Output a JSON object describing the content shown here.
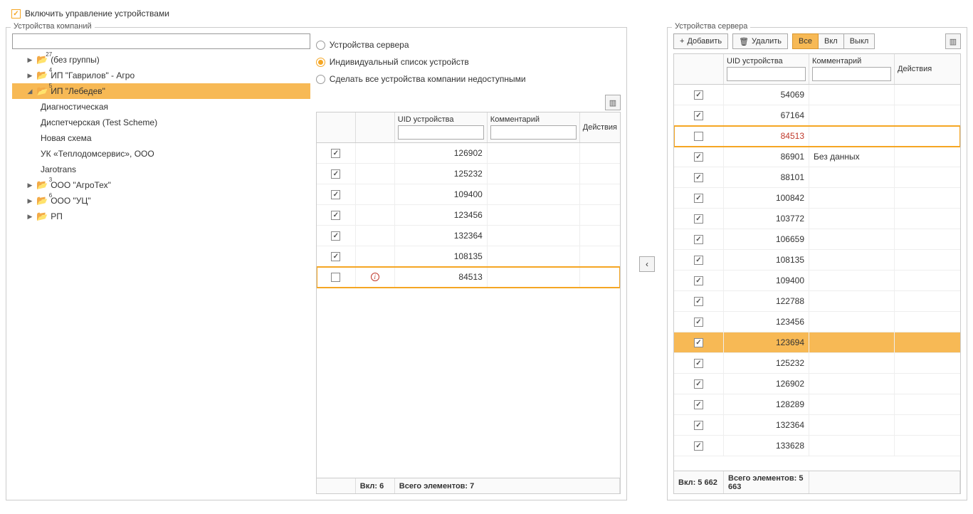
{
  "topCheckbox": {
    "checked": true,
    "label": "Включить управление устройствами"
  },
  "leftPanel": {
    "title": "Устройства компаний",
    "searchValue": "",
    "tree": [
      {
        "arrow": "▶",
        "badge": "27",
        "label": "(без группы)",
        "level": 1,
        "selected": false
      },
      {
        "arrow": "▶",
        "badge": "4",
        "label": "ИП \"Гаврилов\" - Агро",
        "level": 1,
        "selected": false
      },
      {
        "arrow": "◢",
        "badge": "5",
        "label": "ИП \"Лебедев\"",
        "level": 1,
        "selected": true
      },
      {
        "label": "Диагностическая",
        "level": 2
      },
      {
        "label": "Диспетчерская (Test Scheme)",
        "level": 2
      },
      {
        "label": "Новая схема",
        "level": 2
      },
      {
        "label": "УК «Теплодомсервис», ООО",
        "level": 2
      },
      {
        "label": "Jarotrans",
        "level": 2
      },
      {
        "arrow": "▶",
        "badge": "3",
        "label": "ООО \"АгроТех\"",
        "level": 1
      },
      {
        "arrow": "▶",
        "badge": "6",
        "label": "ООО \"УЦ\"",
        "level": 1
      },
      {
        "arrow": "▶",
        "badge": "",
        "label": "РП",
        "level": 1
      }
    ],
    "radios": [
      {
        "label": "Устройства сервера",
        "selected": false
      },
      {
        "label": "Индивидуальный список устройств",
        "selected": true
      },
      {
        "label": "Сделать все устройства компании недоступными",
        "selected": false
      }
    ],
    "grid": {
      "headers": {
        "uid": "UID устройства",
        "comment": "Комментарий",
        "actions": "Действия"
      },
      "filters": {
        "uid": "",
        "comment": ""
      },
      "rows": [
        {
          "checked": true,
          "info": false,
          "uid": "126902",
          "comment": "",
          "highlight": false
        },
        {
          "checked": true,
          "info": false,
          "uid": "125232",
          "comment": "",
          "highlight": false
        },
        {
          "checked": true,
          "info": false,
          "uid": "109400",
          "comment": "",
          "highlight": false
        },
        {
          "checked": true,
          "info": false,
          "uid": "123456",
          "comment": "",
          "highlight": false
        },
        {
          "checked": true,
          "info": false,
          "uid": "132364",
          "comment": "",
          "highlight": false
        },
        {
          "checked": true,
          "info": false,
          "uid": "108135",
          "comment": "",
          "highlight": false
        },
        {
          "checked": false,
          "info": true,
          "uid": "84513",
          "comment": "",
          "highlight": true
        }
      ],
      "footer": {
        "onLabel": "Вкл: 6",
        "totalLabel": "Всего элементов: 7"
      }
    }
  },
  "dividerArrow": "‹",
  "rightPanel": {
    "title": "Устройства сервера",
    "buttons": {
      "add": "Добавить",
      "delete": "Удалить",
      "all": "Все",
      "on": "Вкл",
      "off": "Выкл"
    },
    "grid": {
      "headers": {
        "uid": "UID устройства",
        "comment": "Комментарий",
        "actions": "Действия"
      },
      "filters": {
        "uid": "",
        "comment": ""
      },
      "rows": [
        {
          "checked": true,
          "uid": "54069",
          "comment": ""
        },
        {
          "checked": true,
          "uid": "67164",
          "comment": ""
        },
        {
          "checked": false,
          "uid": "84513",
          "comment": "",
          "highlight": true,
          "red": true
        },
        {
          "checked": true,
          "uid": "86901",
          "comment": "Без данных"
        },
        {
          "checked": true,
          "uid": "88101",
          "comment": ""
        },
        {
          "checked": true,
          "uid": "100842",
          "comment": ""
        },
        {
          "checked": true,
          "uid": "103772",
          "comment": ""
        },
        {
          "checked": true,
          "uid": "106659",
          "comment": ""
        },
        {
          "checked": true,
          "uid": "108135",
          "comment": ""
        },
        {
          "checked": true,
          "uid": "109400",
          "comment": ""
        },
        {
          "checked": true,
          "uid": "122788",
          "comment": ""
        },
        {
          "checked": true,
          "uid": "123456",
          "comment": ""
        },
        {
          "checked": true,
          "uid": "123694",
          "comment": "",
          "selected": true
        },
        {
          "checked": true,
          "uid": "125232",
          "comment": ""
        },
        {
          "checked": true,
          "uid": "126902",
          "comment": ""
        },
        {
          "checked": true,
          "uid": "128289",
          "comment": ""
        },
        {
          "checked": true,
          "uid": "132364",
          "comment": ""
        },
        {
          "checked": true,
          "uid": "133628",
          "comment": ""
        }
      ],
      "footer": {
        "onLabel": "Вкл: 5 662",
        "totalLabel": "Всего элементов: 5 663"
      }
    }
  }
}
